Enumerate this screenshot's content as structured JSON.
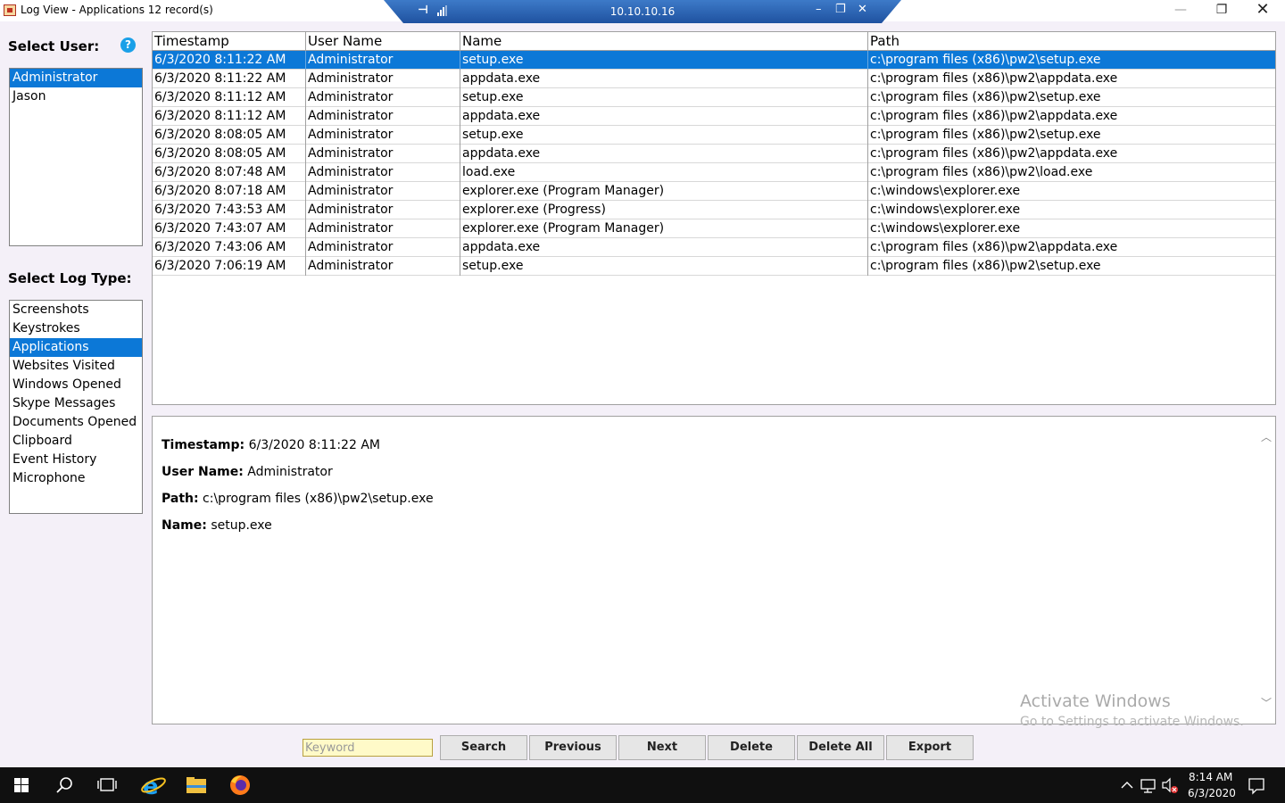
{
  "window": {
    "title": "Log View - Applications 12 record(s)",
    "min_glyph": "—",
    "max_glyph": "❐",
    "close_glyph": "✕"
  },
  "rdp": {
    "host": "10.10.10.16",
    "pin_glyph": "⊣",
    "min_glyph": "–",
    "restore_glyph": "❐",
    "close_glyph": "✕"
  },
  "users": {
    "label": "Select User:",
    "help": "?",
    "items": [
      {
        "label": "Administrator",
        "selected": true
      },
      {
        "label": "Jason",
        "selected": false
      }
    ]
  },
  "log_types": {
    "label": "Select Log Type:",
    "items": [
      {
        "label": "Screenshots",
        "selected": false
      },
      {
        "label": "Keystrokes",
        "selected": false
      },
      {
        "label": "Applications",
        "selected": true
      },
      {
        "label": "Websites Visited",
        "selected": false
      },
      {
        "label": "Windows Opened",
        "selected": false
      },
      {
        "label": "Skype Messages",
        "selected": false
      },
      {
        "label": "Documents Opened",
        "selected": false
      },
      {
        "label": "Clipboard",
        "selected": false
      },
      {
        "label": "Event History",
        "selected": false
      },
      {
        "label": "Microphone",
        "selected": false
      }
    ]
  },
  "table": {
    "columns": [
      "Timestamp",
      "User Name",
      "Name",
      "Path"
    ],
    "rows": [
      [
        "6/3/2020 8:11:22 AM",
        "Administrator",
        "setup.exe",
        "c:\\program files (x86)\\pw2\\setup.exe"
      ],
      [
        "6/3/2020 8:11:22 AM",
        "Administrator",
        "appdata.exe",
        "c:\\program files (x86)\\pw2\\appdata.exe"
      ],
      [
        "6/3/2020 8:11:12 AM",
        "Administrator",
        "setup.exe",
        "c:\\program files (x86)\\pw2\\setup.exe"
      ],
      [
        "6/3/2020 8:11:12 AM",
        "Administrator",
        "appdata.exe",
        "c:\\program files (x86)\\pw2\\appdata.exe"
      ],
      [
        "6/3/2020 8:08:05 AM",
        "Administrator",
        "setup.exe",
        "c:\\program files (x86)\\pw2\\setup.exe"
      ],
      [
        "6/3/2020 8:08:05 AM",
        "Administrator",
        "appdata.exe",
        "c:\\program files (x86)\\pw2\\appdata.exe"
      ],
      [
        "6/3/2020 8:07:48 AM",
        "Administrator",
        "load.exe",
        "c:\\program files (x86)\\pw2\\load.exe"
      ],
      [
        "6/3/2020 8:07:18 AM",
        "Administrator",
        "explorer.exe (Program Manager)",
        "c:\\windows\\explorer.exe"
      ],
      [
        "6/3/2020 7:43:53 AM",
        "Administrator",
        "explorer.exe (Progress)",
        "c:\\windows\\explorer.exe"
      ],
      [
        "6/3/2020 7:43:07 AM",
        "Administrator",
        "explorer.exe (Program Manager)",
        "c:\\windows\\explorer.exe"
      ],
      [
        "6/3/2020 7:43:06 AM",
        "Administrator",
        "appdata.exe",
        "c:\\program files (x86)\\pw2\\appdata.exe"
      ],
      [
        "6/3/2020 7:06:19 AM",
        "Administrator",
        "setup.exe",
        "c:\\program files (x86)\\pw2\\setup.exe"
      ]
    ],
    "selected_row": 0
  },
  "detail": {
    "timestamp_label": "Timestamp:",
    "timestamp_value": "6/3/2020 8:11:22 AM",
    "user_label": "User Name:",
    "user_value": "Administrator",
    "path_label": "Path:",
    "path_value": "c:\\program files (x86)\\pw2\\setup.exe",
    "name_label": "Name:",
    "name_value": "setup.exe",
    "scroll_up_glyph": "︿",
    "scroll_down_glyph": "﹀"
  },
  "watermark": {
    "line1": "Activate Windows",
    "line2": "Go to Settings to activate Windows."
  },
  "toolbar": {
    "keyword_placeholder": "Keyword",
    "keyword_value": "",
    "search": "Search",
    "previous": "Previous",
    "next": "Next",
    "delete": "Delete",
    "delete_all": "Delete All",
    "export": "Export"
  },
  "taskbar": {
    "time": "8:14 AM",
    "date": "6/3/2020",
    "icons": [
      "windows-start-icon",
      "search-icon",
      "task-view-icon",
      "internet-explorer-icon",
      "file-explorer-icon",
      "firefox-icon"
    ],
    "tray_icons": [
      "chevron-up-icon",
      "network-icon",
      "volume-muted-icon",
      "notification-icon"
    ],
    "colors": {
      "background": "#101010",
      "selection": "#0c78d7"
    }
  }
}
